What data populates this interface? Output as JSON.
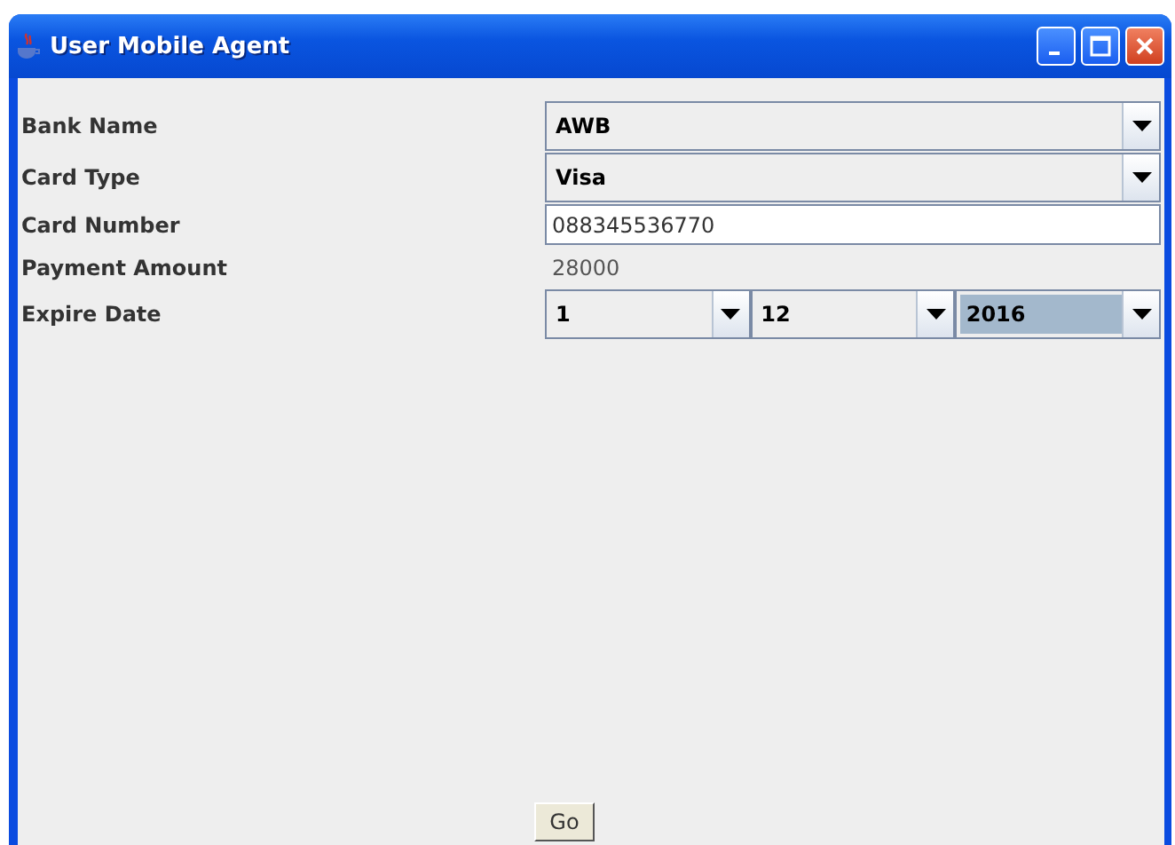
{
  "window": {
    "title": "User Mobile Agent"
  },
  "fields": [
    {
      "label": "Bank Name",
      "kind": "combo",
      "values": [
        {
          "value": "AWB",
          "focused": false
        }
      ]
    },
    {
      "label": "Card Type",
      "kind": "combo",
      "values": [
        {
          "value": "Visa",
          "focused": false
        }
      ]
    },
    {
      "label": "Card Number",
      "kind": "text",
      "value": "088345536770"
    },
    {
      "label": "Payment Amount",
      "kind": "readonly",
      "value": "28000"
    },
    {
      "label": "Expire Date",
      "kind": "combo",
      "values": [
        {
          "value": "1",
          "focused": false
        },
        {
          "value": "12",
          "focused": false
        },
        {
          "value": "2016",
          "focused": true
        }
      ]
    }
  ],
  "buttons": [
    "Go"
  ]
}
